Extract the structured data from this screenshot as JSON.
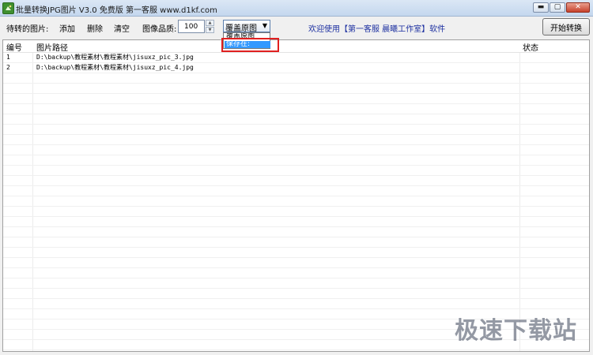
{
  "window": {
    "title": "批量转换JPG图片 V3.0 免费版      第一客服 www.d1kf.com",
    "controls": {
      "minimize": "▬",
      "maximize": "▢",
      "close": "✕"
    }
  },
  "toolbar": {
    "pending_label": "待转的图片:",
    "add_label": "添加",
    "delete_label": "删除",
    "clear_label": "清空",
    "quality_label": "图像品质:",
    "quality_value": "100",
    "output_mode_selected": "覆盖原图",
    "welcome_text": "欢迎使用【第一客服 晨曦工作室】软件",
    "start_label": "开始转换"
  },
  "dropdown": {
    "options": [
      "覆盖原图",
      "保存在:"
    ],
    "highlighted_index": 1
  },
  "list": {
    "columns": [
      "编号",
      "图片路径",
      "状态"
    ],
    "rows": [
      {
        "id": "1",
        "path": "D:\\backup\\教程素材\\教程素材\\jisuxz_pic_3.jpg",
        "status": ""
      },
      {
        "id": "2",
        "path": "D:\\backup\\教程素材\\教程素材\\jisuxz_pic_4.jpg",
        "status": ""
      }
    ]
  },
  "watermark": {
    "text": "极速下载站"
  },
  "colors": {
    "welcome_text": "#1c2fa0",
    "highlight_box": "#e02020",
    "dropdown_selection": "#3399ff"
  }
}
